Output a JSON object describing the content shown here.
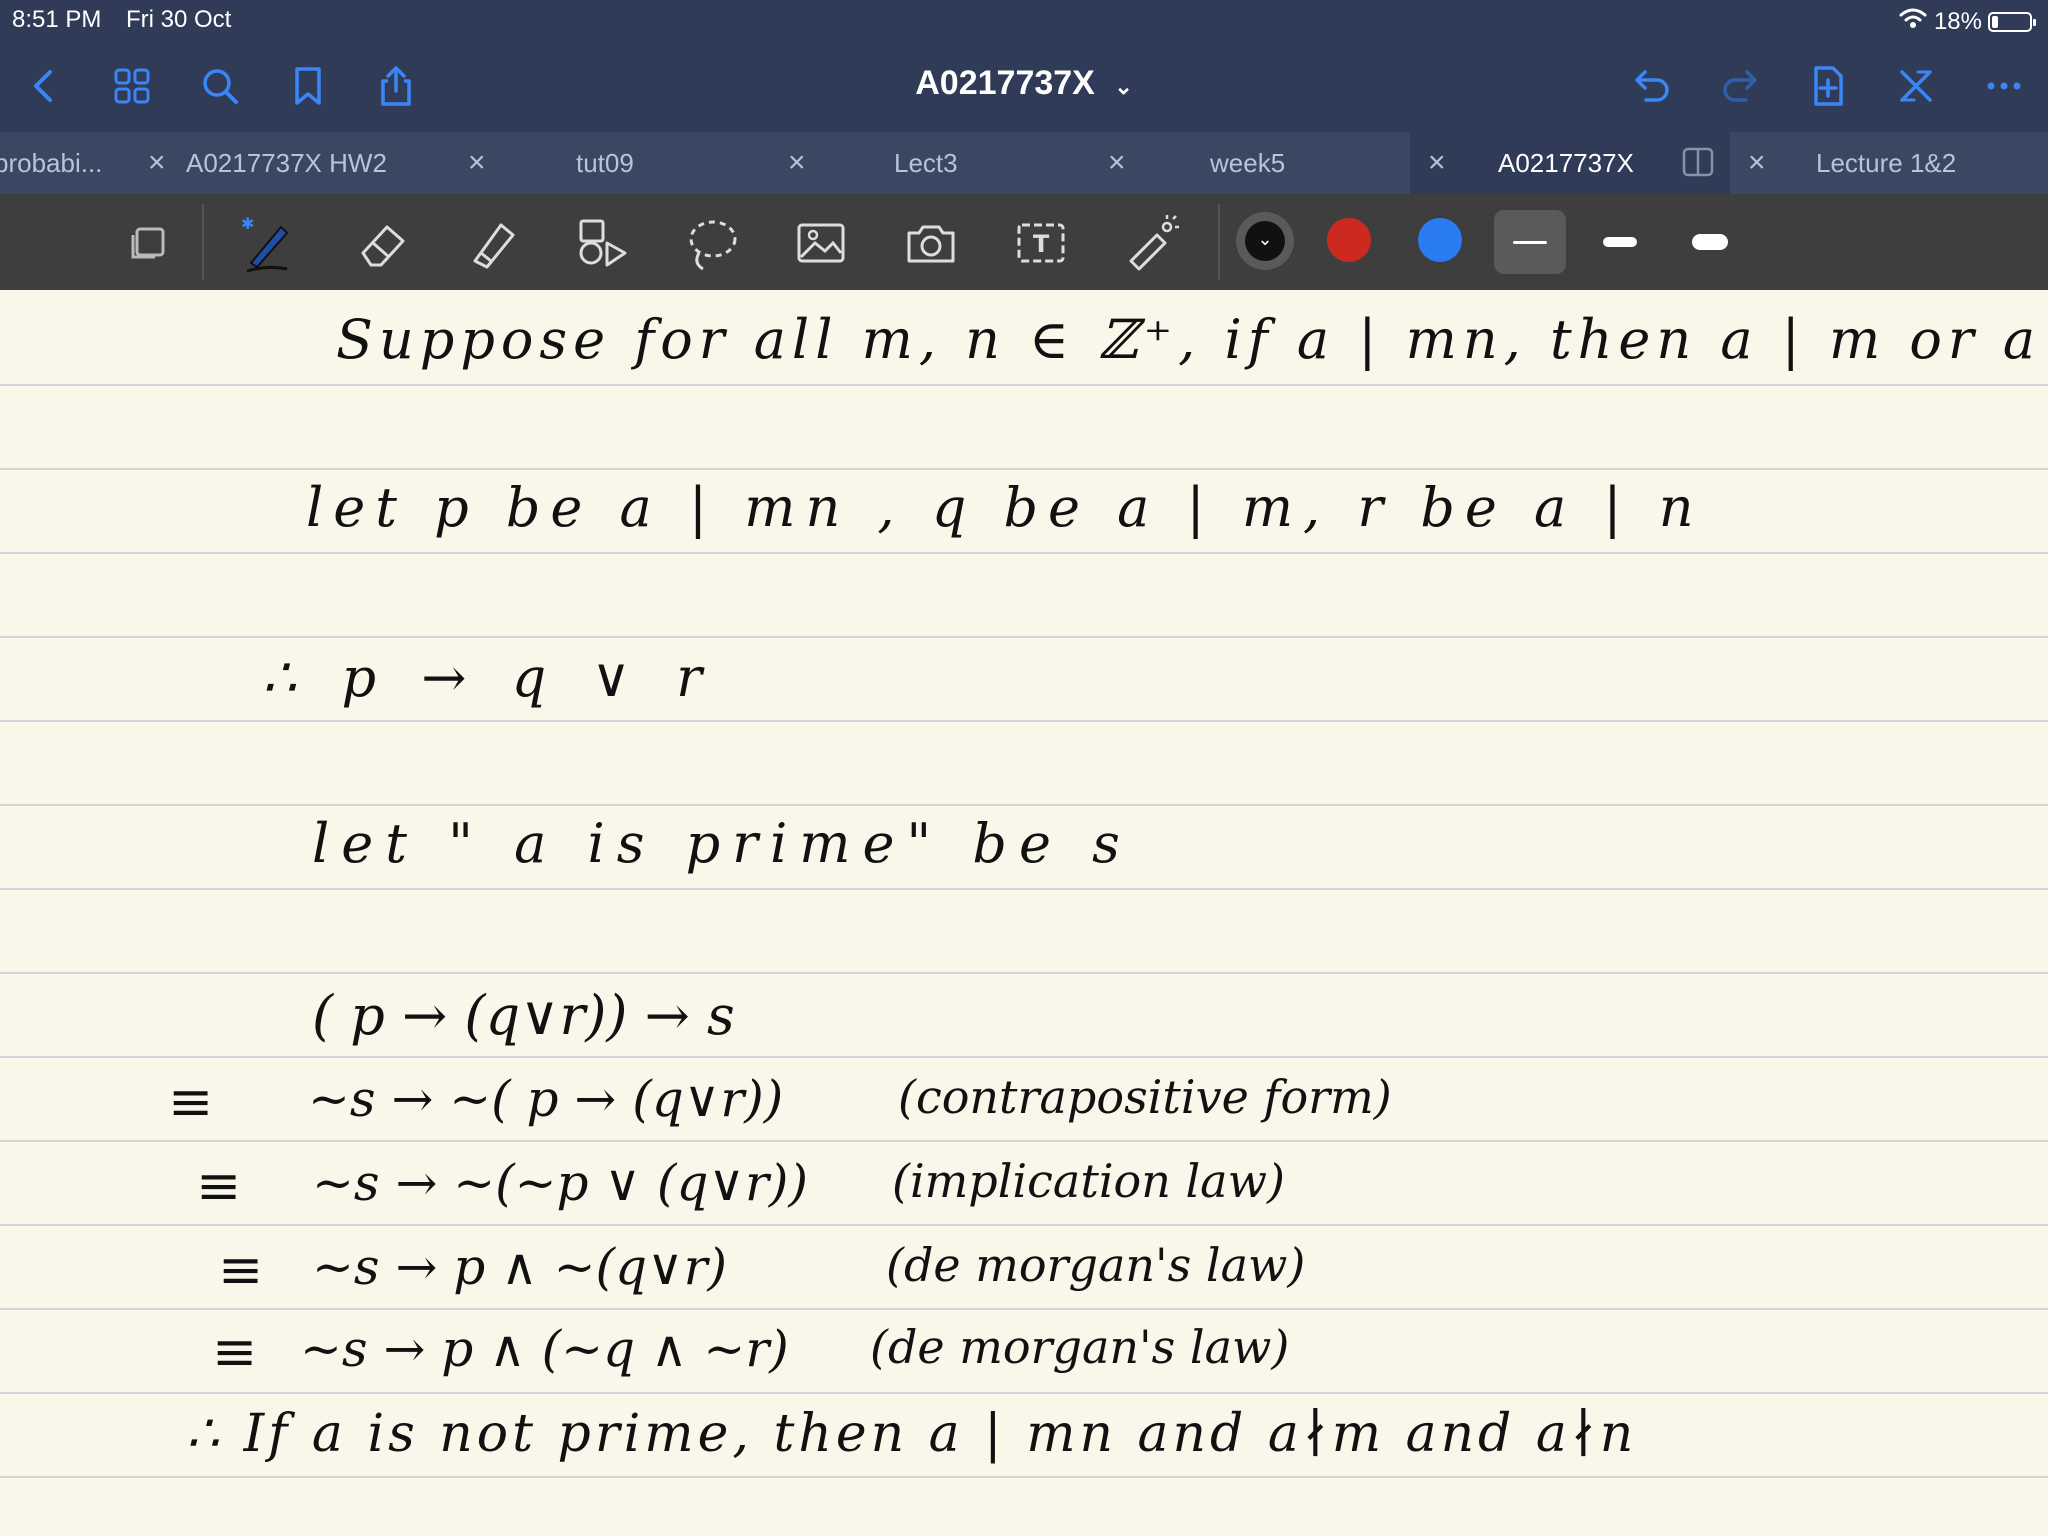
{
  "status": {
    "time": "8:51 PM",
    "date": "Fri 30 Oct",
    "battery": "18%",
    "battery_level": 0.18
  },
  "nav": {
    "title": "A0217737X",
    "left_icons": [
      "back-icon",
      "grid-icon",
      "search-icon",
      "bookmark-icon",
      "share-icon"
    ],
    "right_icons": [
      "undo-icon",
      "redo-icon",
      "add-page-icon",
      "close-doc-icon",
      "more-icon"
    ]
  },
  "tabs": [
    {
      "label": "probabi...",
      "active": false
    },
    {
      "label": "A0217737X HW2",
      "active": false
    },
    {
      "label": "tut09",
      "active": false
    },
    {
      "label": "Lect3",
      "active": false
    },
    {
      "label": "week5",
      "active": false
    },
    {
      "label": "A0217737X",
      "active": true
    },
    {
      "label": "Lecture 1&2",
      "active": false
    }
  ],
  "toolbar": {
    "tools": [
      "page-thumbnail-tool",
      "pen-tool",
      "eraser-tool",
      "highlighter-tool",
      "shapes-tool",
      "lasso-tool",
      "image-tool",
      "camera-tool",
      "text-tool",
      "laser-pointer-tool"
    ],
    "colors": [
      "#111111",
      "#cc2a21",
      "#2b7bf2"
    ],
    "selected_color": 0,
    "stroke_sizes": [
      "thin",
      "medium",
      "thick"
    ],
    "selected_stroke": 0
  },
  "notes": {
    "line1": "Suppose for all m, n ∈ ℤ⁺, if a | mn, then a | m or a | n.",
    "line2": "let p be a | mn , q be a | m, r be a | n",
    "line3": "∴ p → q ∨ r",
    "line4": "let \" a is prime\" be s",
    "line5": "( p → (q∨r)) → s",
    "line6_op": "≡",
    "line6": "~s → ~( p → (q∨r))",
    "line6_note": "(contrapositive form)",
    "line7_op": "≡",
    "line7": "~s → ~(~p ∨ (q∨r))",
    "line7_note": "(implication law)",
    "line8_op": "≡",
    "line8": "~s → p ∧ ~(q∨r)",
    "line8_note": "(de morgan's law)",
    "line9_op": "≡",
    "line9": "~s → p ∧ (~q ∧ ~r)",
    "line9_note": "(de morgan's law)",
    "line10": "∴ If a is not prime, then a | mn and a∤m and a∤n"
  }
}
